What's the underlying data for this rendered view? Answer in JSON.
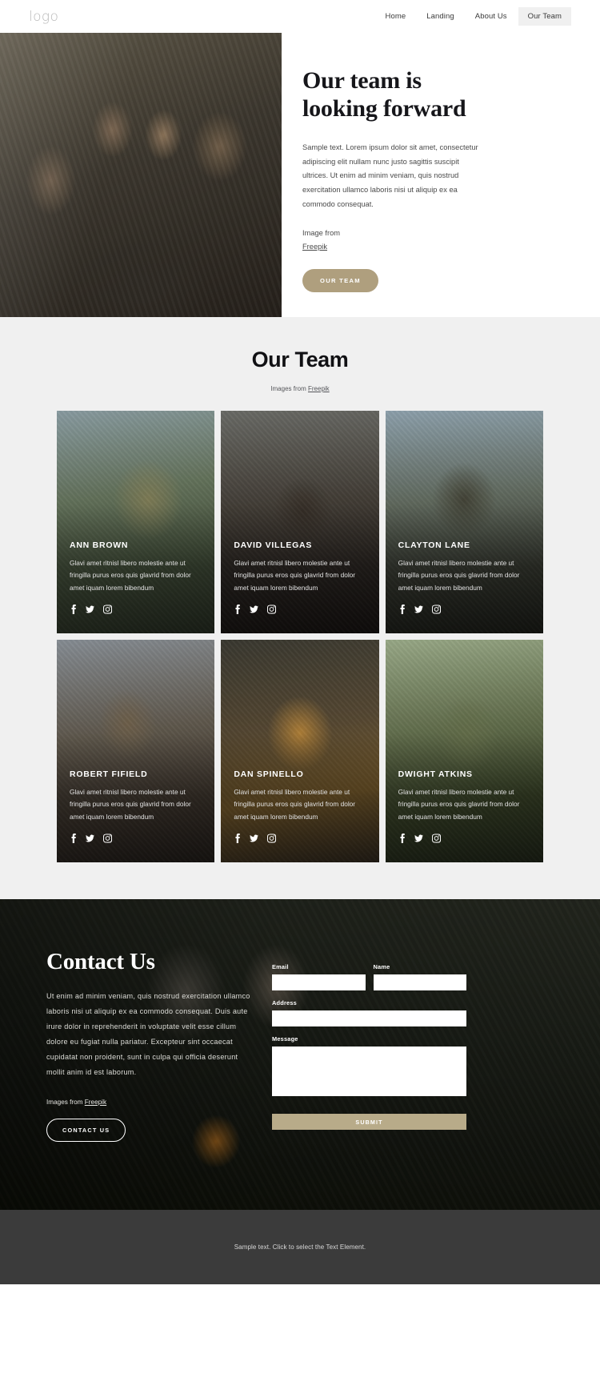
{
  "header": {
    "logo": "logo",
    "nav": [
      {
        "label": "Home",
        "active": false
      },
      {
        "label": "Landing",
        "active": false
      },
      {
        "label": "About Us",
        "active": false
      },
      {
        "label": "Our Team",
        "active": true
      }
    ]
  },
  "hero": {
    "title": "Our team is looking forward",
    "text": "Sample text. Lorem ipsum dolor sit amet, consectetur adipiscing elit nullam nunc justo sagittis suscipit ultrices. Ut enim ad minim veniam, quis nostrud exercitation ullamco laboris nisi ut aliquip ex ea commodo consequat.",
    "credit_prefix": "Image from",
    "credit_link": "Freepik",
    "button": "OUR TEAM",
    "button_color": "#af9f7e",
    "image_alt": "group-of-men-looking-at-tablet"
  },
  "team": {
    "title": "Our Team",
    "subtitle_prefix": "Images from",
    "subtitle_link": "Freepik",
    "members": [
      {
        "name": "ANN BROWN",
        "description": "Glavi amet ritnisl libero molestie ante ut fringilla purus eros quis glavrid from dolor amet iquam lorem bibendum",
        "image_alt": "woman-with-camera-in-mountains"
      },
      {
        "name": "DAVID VILLEGAS",
        "description": "Glavi amet ritnisl libero molestie ante ut fringilla purus eros quis glavrid from dolor amet iquam lorem bibendum",
        "image_alt": "man-with-beanie-holding-mug"
      },
      {
        "name": "CLAYTON LANE",
        "description": "Glavi amet ritnisl libero molestie ante ut fringilla purus eros quis glavrid from dolor amet iquam lorem bibendum",
        "image_alt": "man-with-backpack-at-sunset"
      },
      {
        "name": "ROBERT FIFIELD",
        "description": "Glavi amet ritnisl libero molestie ante ut fringilla purus eros quis glavrid from dolor amet iquam lorem bibendum",
        "image_alt": "smiling-hiker-with-backpack"
      },
      {
        "name": "DAN SPINELLO",
        "description": "Glavi amet ritnisl libero molestie ante ut fringilla purus eros quis glavrid from dolor amet iquam lorem bibendum",
        "image_alt": "bearded-man-with-glasses-in-yellow-jacket"
      },
      {
        "name": "DWIGHT ATKINS",
        "description": "Glavi amet ritnisl libero molestie ante ut fringilla purus eros quis glavrid from dolor amet iquam lorem bibendum",
        "image_alt": "man-with-cap-in-forest"
      }
    ],
    "social_icons": [
      "facebook-icon",
      "twitter-icon",
      "instagram-icon"
    ]
  },
  "contact": {
    "title": "Contact Us",
    "text": "Ut enim ad minim veniam, quis nostrud exercitation ullamco laboris nisi ut aliquip ex ea commodo consequat. Duis aute irure dolor in reprehenderit in voluptate velit esse cillum dolore eu fugiat nulla pariatur. Excepteur sint occaecat cupidatat non proident, sunt in culpa qui officia deserunt mollit anim id est laborum.",
    "credit_prefix": "Images from",
    "credit_link": "Freepik",
    "button": "CONTACT US",
    "image_alt": "couple-camping-by-tent-with-campfire",
    "form": {
      "email_label": "Email",
      "email_value": "",
      "name_label": "Name",
      "name_value": "",
      "address_label": "Address",
      "address_value": "",
      "message_label": "Message",
      "message_value": "",
      "submit_label": "SUBMIT",
      "submit_color": "#b8ab89"
    }
  },
  "footer": {
    "text": "Sample text. Click to select the Text Element."
  }
}
